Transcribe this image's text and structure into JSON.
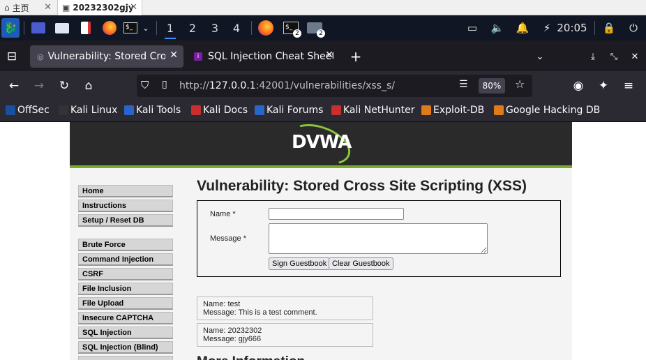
{
  "outer_tabs": [
    {
      "label": "主页"
    },
    {
      "label": "20232302gjy"
    }
  ],
  "taskbar": {
    "workspaces": [
      "1",
      "2",
      "3",
      "4"
    ],
    "terminal_badge": "2",
    "files_badge": "2",
    "clock": "20:05"
  },
  "firefox_tabs": [
    {
      "label": "Vulnerability: Stored Cros"
    },
    {
      "label": "SQL Injection Cheat Sheet"
    }
  ],
  "navbar": {
    "url_prefix": "http://",
    "url_host": "127.0.0.1",
    "url_rest": ":42001/vulnerabilities/xss_s/",
    "zoom": "80%"
  },
  "bookmarks": [
    {
      "label": "OffSec",
      "color": "#1a4fa0"
    },
    {
      "label": "Kali Linux",
      "color": "#333333"
    },
    {
      "label": "Kali Tools",
      "color": "#2a66c9"
    },
    {
      "label": "Kali Docs",
      "color": "#c9302c"
    },
    {
      "label": "Kali Forums",
      "color": "#2a66c9"
    },
    {
      "label": "Kali NetHunter",
      "color": "#c9302c"
    },
    {
      "label": "Exploit-DB",
      "color": "#e07b1a"
    },
    {
      "label": "Google Hacking DB",
      "color": "#e07b1a"
    }
  ],
  "dvwa": {
    "logo": "DVWA",
    "menu": [
      "Home",
      "Instructions",
      "Setup / Reset DB",
      "Brute Force",
      "Command Injection",
      "CSRF",
      "File Inclusion",
      "File Upload",
      "Insecure CAPTCHA",
      "SQL Injection",
      "SQL Injection (Blind)"
    ],
    "page_title": "Vulnerability: Stored Cross Site Scripting (XSS)",
    "form": {
      "name_label": "Name *",
      "message_label": "Message *",
      "name_value": "",
      "sign_button": "Sign Guestbook",
      "clear_button": "Clear Guestbook"
    },
    "entries": [
      {
        "name": "Name: test",
        "message": "Message: This is a test comment."
      },
      {
        "name": "Name: 20232302",
        "message": "Message: gjy666"
      }
    ],
    "more_info": "More Information"
  }
}
